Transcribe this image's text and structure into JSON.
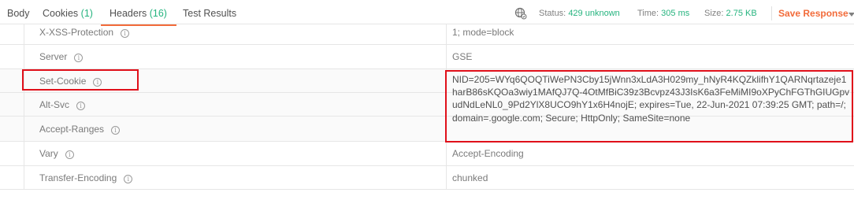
{
  "tabs": [
    {
      "label": "Body",
      "count": ""
    },
    {
      "label": "Cookies",
      "count": "(1)"
    },
    {
      "label": "Headers",
      "count": "(16)"
    },
    {
      "label": "Test Results",
      "count": ""
    }
  ],
  "status_bar": {
    "status_label": "Status:",
    "status_value": "429 unknown",
    "time_label": "Time:",
    "time_value": "305 ms",
    "size_label": "Size:",
    "size_value": "2.75 KB",
    "save_label": "Save Response"
  },
  "colors": {
    "accent": "#f26b3a",
    "status_green": "#26b47f",
    "highlight_red": "#e0101a"
  },
  "headers": [
    {
      "key": "X-XSS-Protection",
      "value": "1; mode=block"
    },
    {
      "key": "Server",
      "value": "GSE"
    },
    {
      "key": "Set-Cookie",
      "value": "NID=205=WYq6QOQTiWePN3Cby15jWnn3xLdA3H029my_hNyR4KQZklifhY1QARNqrtazeje1harB86sKQOa3wiy1MAfQJ7Q-4OtMfBiC39z3Bcvpz43J3IsK6a3FeMiMI9oXPyChFGThGIUGpvudNdLeNL0_9Pd2YlX8UCO9hY1x6H4nojE; expires=Tue, 22-Jun-2021 07:39:25 GMT; path=/; domain=.google.com; Secure; HttpOnly; SameSite=none"
    },
    {
      "key": "Alt-Svc",
      "value": ""
    },
    {
      "key": "Accept-Ranges",
      "value": ""
    },
    {
      "key": "Vary",
      "value": "Accept-Encoding"
    },
    {
      "key": "Transfer-Encoding",
      "value": "chunked"
    }
  ],
  "info_glyph": "i"
}
